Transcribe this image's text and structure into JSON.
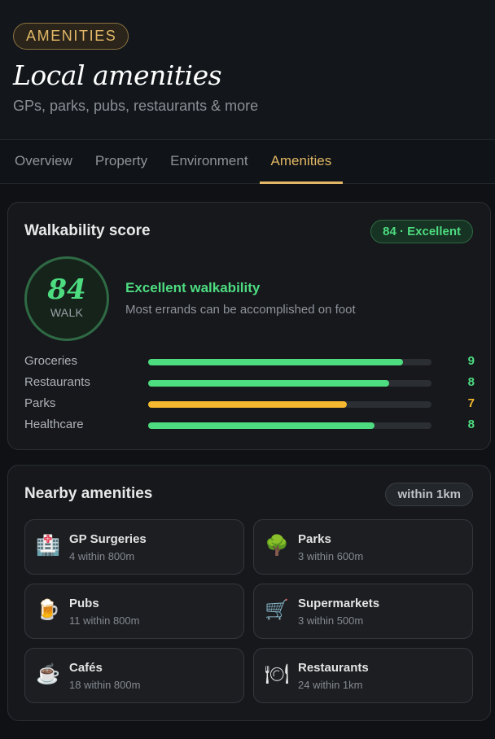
{
  "header": {
    "badge": "AMENITIES",
    "title": "Local amenities",
    "subtitle": "GPs, parks, pubs, restaurants & more"
  },
  "tabs": [
    {
      "label": "Overview",
      "active": false
    },
    {
      "label": "Property",
      "active": false
    },
    {
      "label": "Environment",
      "active": false
    },
    {
      "label": "Amenities",
      "active": true
    }
  ],
  "walkability": {
    "title": "Walkability score",
    "badge": "84 · Excellent",
    "score": "84",
    "score_label": "WALK",
    "heading": "Excellent walkability",
    "description": "Most errands can be accomplished on foot",
    "metrics": [
      {
        "label": "Groceries",
        "value": "9",
        "fill_fraction": 0.9,
        "color": "#4ddc80"
      },
      {
        "label": "Restaurants",
        "value": "8",
        "fill_fraction": 0.85,
        "color": "#4ddc80"
      },
      {
        "label": "Parks",
        "value": "7",
        "fill_fraction": 0.7,
        "color": "#f5b82e"
      },
      {
        "label": "Healthcare",
        "value": "8",
        "fill_fraction": 0.8,
        "color": "#4ddc80"
      }
    ]
  },
  "nearby": {
    "title": "Nearby amenities",
    "badge": "within 1km",
    "items": [
      {
        "name": "GP Surgeries",
        "detail": "4 within 800m",
        "icon": "hospital-icon",
        "glyph": "🏥"
      },
      {
        "name": "Parks",
        "detail": "3 within 600m",
        "icon": "tree-icon",
        "glyph": "🌳"
      },
      {
        "name": "Pubs",
        "detail": "11 within 800m",
        "icon": "beer-icon",
        "glyph": "🍺"
      },
      {
        "name": "Supermarkets",
        "detail": "3 within 500m",
        "icon": "shopping-cart-icon",
        "glyph": "🛒"
      },
      {
        "name": "Cafés",
        "detail": "18 within 800m",
        "icon": "coffee-icon",
        "glyph": "☕"
      },
      {
        "name": "Restaurants",
        "detail": "24 within 1km",
        "icon": "plate-icon",
        "glyph": "🍽"
      }
    ]
  },
  "colors": {
    "accent": "#e2b866",
    "good": "#4ddc80",
    "warn": "#f5b82e"
  }
}
